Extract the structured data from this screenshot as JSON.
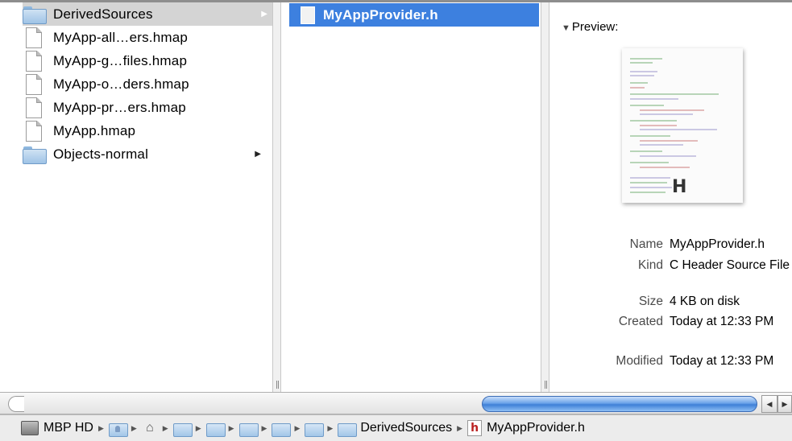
{
  "column1": {
    "items": [
      {
        "label": "DerivedSources",
        "icon": "folder-icon",
        "selected": true,
        "has_children": true
      },
      {
        "label": "MyApp-all…ers.hmap",
        "icon": "document-icon"
      },
      {
        "label": "MyApp-g…files.hmap",
        "icon": "document-icon"
      },
      {
        "label": "MyApp-o…ders.hmap",
        "icon": "document-icon"
      },
      {
        "label": "MyApp-pr…ers.hmap",
        "icon": "document-icon"
      },
      {
        "label": "MyApp.hmap",
        "icon": "document-icon"
      },
      {
        "label": "Objects-normal",
        "icon": "folder-icon",
        "has_children": true
      }
    ]
  },
  "column2": {
    "items": [
      {
        "label": "MyAppProvider.h",
        "icon": "header-file-icon",
        "selected": true
      }
    ]
  },
  "preview": {
    "heading": "Preview:",
    "thumbnail_badge": "H",
    "info": [
      {
        "key": "Name",
        "value": "MyAppProvider.h"
      },
      {
        "key": "Kind",
        "value": "C Header Source File"
      },
      {
        "key": "Size",
        "value": "4 KB on disk"
      },
      {
        "key": "Created",
        "value": "Today at 12:33 PM"
      },
      {
        "key": "Modified",
        "value": "Today at 12:33 PM"
      }
    ]
  },
  "pathbar": {
    "root": "MBP HD",
    "current_folder": "DerivedSources",
    "current_file": "MyAppProvider.h"
  },
  "colors": {
    "selection_blue": "#3d80df",
    "selection_gray": "#d4d4d4",
    "scroll_thumb": "#3e7fd7"
  }
}
